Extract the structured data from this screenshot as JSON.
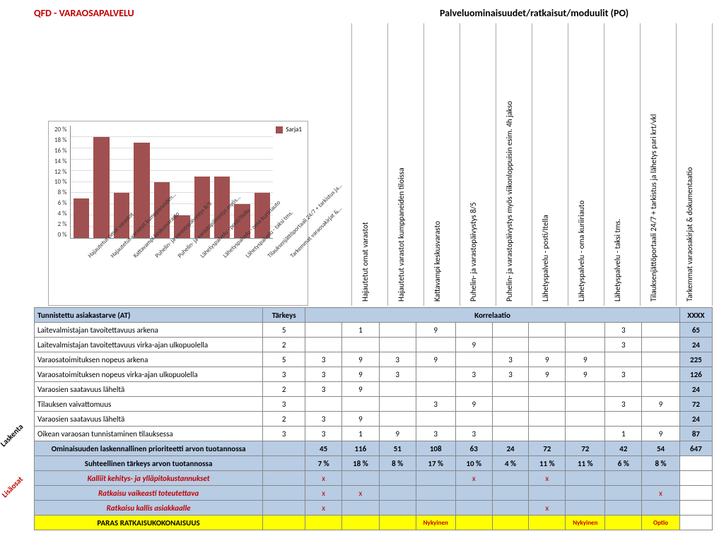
{
  "title_main": "QFD - VARAOSAPALVELU",
  "title_cols": "Palveluominaisuudet/ratkaisut/moduulit (PO)",
  "legend": "Sarja1",
  "chart_data": {
    "type": "bar",
    "title": "",
    "xlabel": "",
    "ylabel": "",
    "ylim": [
      0,
      20
    ],
    "yticks": [
      "0 %",
      "2 %",
      "4 %",
      "6 %",
      "8 %",
      "10 %",
      "12 %",
      "14 %",
      "16 %",
      "18 %",
      "20 %"
    ],
    "categories": [
      "Hajautetut omat varastot",
      "Hajautetut varastot kumppaneiden…",
      "Kattavampi keskusvarasto",
      "Puhelin- ja varastopäivystys 8/5",
      "Puhelin- ja varastopäivystys myös…",
      "Lähetyspalvelu - posti/Itella",
      "Lähetyspalvelu - oma kuriiriauto",
      "Lähetyspalvelu - taksi tms.",
      "Tilauksenjättöportaali 24/7 + tarkistus ja…",
      "Tarkemmat varaosakirjat &…"
    ],
    "values": [
      7,
      18,
      8,
      17,
      10,
      4,
      11,
      11,
      6,
      8
    ],
    "series_name": "Sarja1"
  },
  "column_headers": [
    "Hajautetut omat varastot",
    "Hajautetut varastot kumppaneiden tiloissa",
    "Kattavampi keskusvarasto",
    "Puhelin- ja varastopäivystys 8/5",
    "Puhelin- ja varastopäivystys myös viikonloppuisin esim. 4h jakso",
    "Lähetyspalvelu - posti/Itella",
    "Lähetyspalvelu - oma kuriiriauto",
    "Lähetyspalvelu - taksi tms.",
    "Tilauksenjättöportaali 24/7 + tarkistus ja lähetys pari krt/vkl",
    "Tarkemmat varaosakirjat & dokumentaatio"
  ],
  "hdr_need": "Tunnistettu asiakastarve (AT)",
  "hdr_imp": "Tärkeys",
  "hdr_corr": "Korrelaatio",
  "hdr_sum": "XXXX",
  "side_laskenta": "Laskenta",
  "side_lisaosat": "Lisäosat",
  "needs": [
    {
      "label": "Laitevalmistajan tavoitettavuus arkena",
      "imp": 5,
      "cells": [
        "",
        "1",
        "",
        "9",
        "",
        "",
        "",
        "",
        "3",
        ""
      ],
      "sum": 65
    },
    {
      "label": "Laitevalmistajan tavoitettavuus virka-ajan ulkopuolella",
      "imp": 2,
      "cells": [
        "",
        "",
        "",
        "",
        "9",
        "",
        "",
        "",
        "3",
        ""
      ],
      "sum": 24
    },
    {
      "label": "Varaosatoimituksen nopeus arkena",
      "imp": 5,
      "cells": [
        "3",
        "9",
        "3",
        "9",
        "",
        "3",
        "9",
        "9",
        "",
        ""
      ],
      "sum": 225
    },
    {
      "label": "Varaosatoimituksen nopeus virka-ajan ulkopuolella",
      "imp": 3,
      "cells": [
        "3",
        "9",
        "3",
        "",
        "3",
        "3",
        "9",
        "9",
        "3",
        ""
      ],
      "sum": 126
    },
    {
      "label": "Varaosien saatavuus läheltä",
      "imp": 2,
      "cells": [
        "3",
        "9",
        "",
        "",
        "",
        "",
        "",
        "",
        "",
        ""
      ],
      "sum": 24
    },
    {
      "label": "Tilauksen vaivattomuus",
      "imp": 3,
      "cells": [
        "",
        "",
        "",
        "3",
        "9",
        "",
        "",
        "",
        "3",
        "9"
      ],
      "sum": 72
    },
    {
      "label": "Varaosien saatavuus läheltä",
      "imp": 2,
      "cells": [
        "3",
        "9",
        "",
        "",
        "",
        "",
        "",
        "",
        "",
        ""
      ],
      "sum": 24
    },
    {
      "label": "Oikean varaosan tunnistaminen tilauksessa",
      "imp": 3,
      "cells": [
        "3",
        "1",
        "9",
        "3",
        "3",
        "",
        "",
        "",
        "1",
        "9"
      ],
      "sum": 87
    }
  ],
  "calc_priority": {
    "label": "Ominaisuuden laskennallinen prioriteetti arvon tuotannossa",
    "cells": [
      "45",
      "116",
      "51",
      "108",
      "63",
      "24",
      "72",
      "72",
      "42",
      "54"
    ],
    "sum": "647"
  },
  "rel_importance": {
    "label": "Suhteellinen tärkeys arvon tuotannossa",
    "cells": [
      "7 %",
      "18 %",
      "8 %",
      "17 %",
      "10 %",
      "4 %",
      "11 %",
      "11 %",
      "6 %",
      "8 %"
    ],
    "sum": ""
  },
  "extras": [
    {
      "label": "Kalliit kehitys- ja ylläpitokustannukset",
      "cells": [
        "x",
        "",
        "",
        "",
        "x",
        "",
        "x",
        "",
        "",
        ""
      ],
      "sum": ""
    },
    {
      "label": "Ratkaisu vaikeasti toteutettava",
      "cells": [
        "x",
        "x",
        "",
        "",
        "",
        "",
        "",
        "",
        "",
        "x"
      ],
      "sum": ""
    },
    {
      "label": "Ratkaisu kallis asiakkaalle",
      "cells": [
        "x",
        "",
        "",
        "",
        "",
        "",
        "x",
        "",
        "",
        ""
      ],
      "sum": ""
    }
  ],
  "best": {
    "label": "PARAS RATKAISUKOKONAISUUS",
    "cells": [
      "",
      "",
      "",
      "Nykyinen",
      "",
      "",
      "",
      "Nykyinen",
      "",
      "Optio"
    ],
    "sum": ""
  }
}
